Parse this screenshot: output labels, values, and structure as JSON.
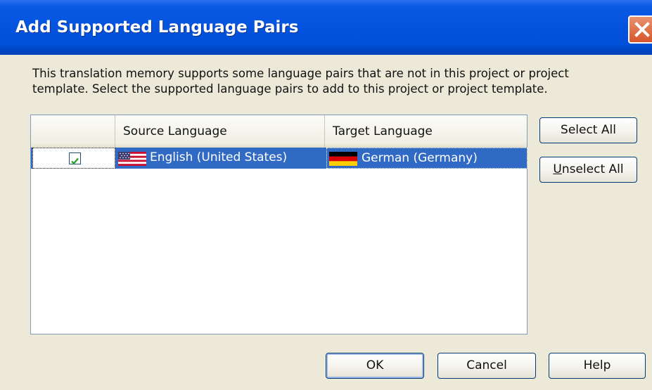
{
  "dialog": {
    "title": "Add Supported Language Pairs",
    "description_line1": "This translation memory supports some language pairs that are not in this project or project",
    "description_line2": "template. Select the supported language pairs to add to this project or project template."
  },
  "grid": {
    "columns": [
      "",
      "Source Language",
      "Target Language"
    ],
    "rows": [
      {
        "checked": true,
        "source": "English (United States)",
        "source_flag": "us-flag-icon",
        "target": "German (Germany)",
        "target_flag": "germany-flag-icon"
      }
    ]
  },
  "side_buttons": {
    "select_all": "Select All",
    "unselect_first": "U",
    "unselect_rest": "nselect All"
  },
  "footer": {
    "ok": "OK",
    "cancel": "Cancel",
    "help": "Help"
  },
  "colors": {
    "title_bar": "#0054e3",
    "selection": "#316ac5",
    "close_button": "#d6552c"
  }
}
